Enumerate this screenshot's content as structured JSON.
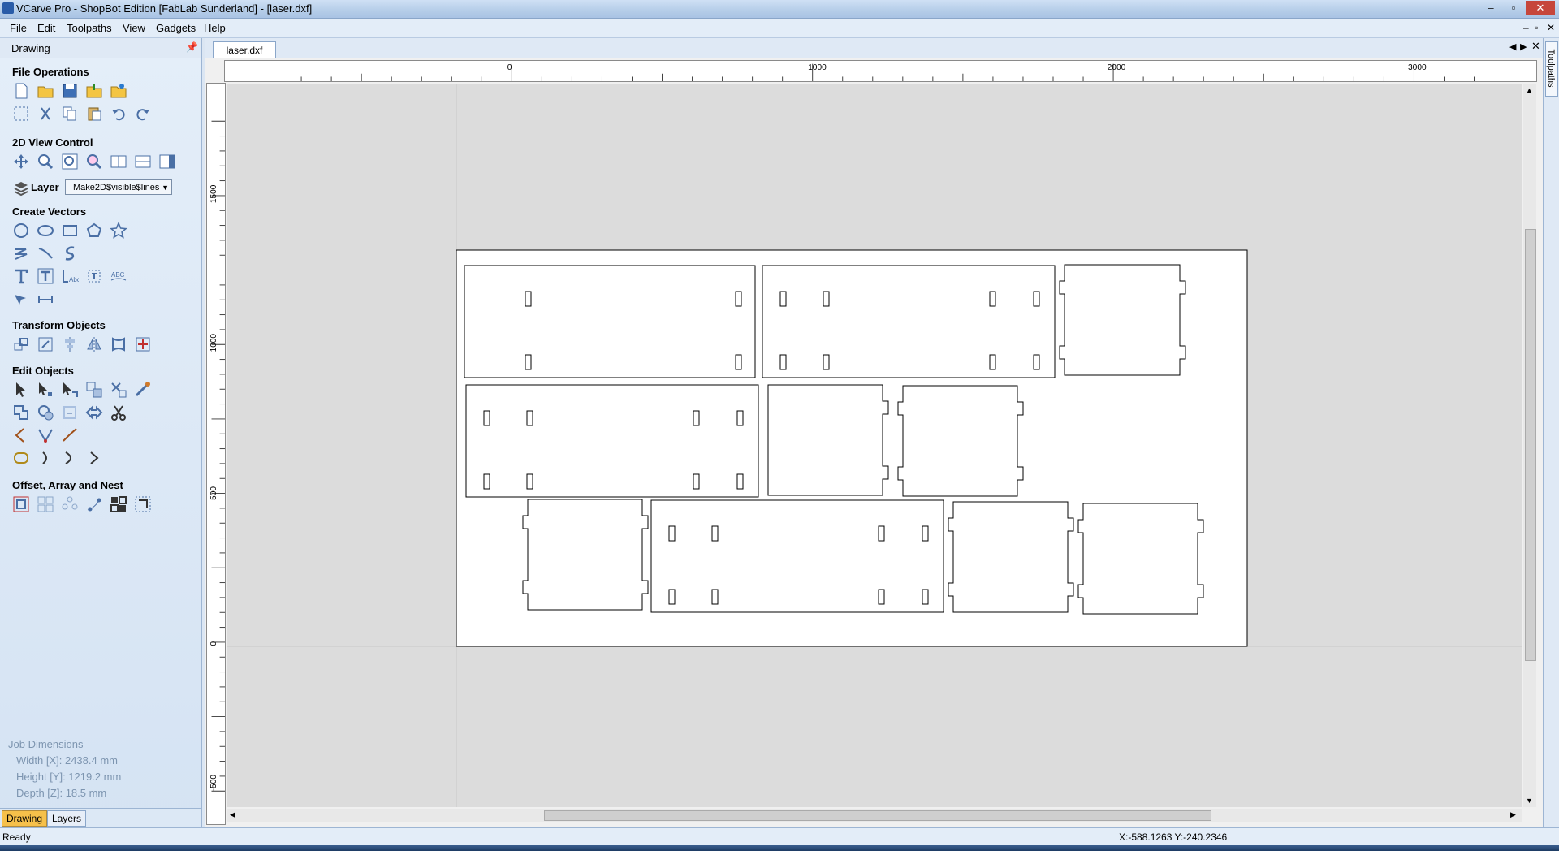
{
  "window": {
    "title": "VCarve Pro - ShopBot Edition [FabLab Sunderland] - [laser.dxf]",
    "controls": [
      "–",
      "▫",
      "✕"
    ],
    "mdi_controls": [
      "–",
      "▫",
      "✕"
    ]
  },
  "menu": [
    "File",
    "Edit",
    "Toolpaths",
    "View",
    "Gadgets",
    "Help"
  ],
  "panel": {
    "title": "Drawing",
    "sections": {
      "file_operations": "File Operations",
      "view_control": "2D View Control",
      "create_vectors": "Create Vectors",
      "transform_objects": "Transform Objects",
      "edit_objects": "Edit Objects",
      "offset_array_nest": "Offset, Array and Nest"
    },
    "layer_label": "Layer",
    "layer_value": "Make2D$visible$lines",
    "job": {
      "title": "Job Dimensions",
      "width": "Width  [X]: 2438.4 mm",
      "height": "Height [Y]: 1219.2 mm",
      "depth": "Depth  [Z]: 18.5 mm"
    },
    "tabs": [
      "Drawing",
      "Layers"
    ]
  },
  "document_tab": "laser.dxf",
  "right_tab": "Toolpaths",
  "rulers": {
    "x_labels": [
      "0",
      "1000",
      "2000",
      "3000"
    ],
    "y_labels": [
      "1500",
      "1000",
      "500",
      "0",
      "-500"
    ]
  },
  "status": {
    "left": "Ready",
    "right": "X:-588.1263 Y:-240.2346"
  },
  "colors": {
    "panel_bg": "#dbe6f3",
    "canvas_bg": "#dcdcdc",
    "sheet": "#ffffff",
    "accent_tab": "#f6c04a"
  }
}
